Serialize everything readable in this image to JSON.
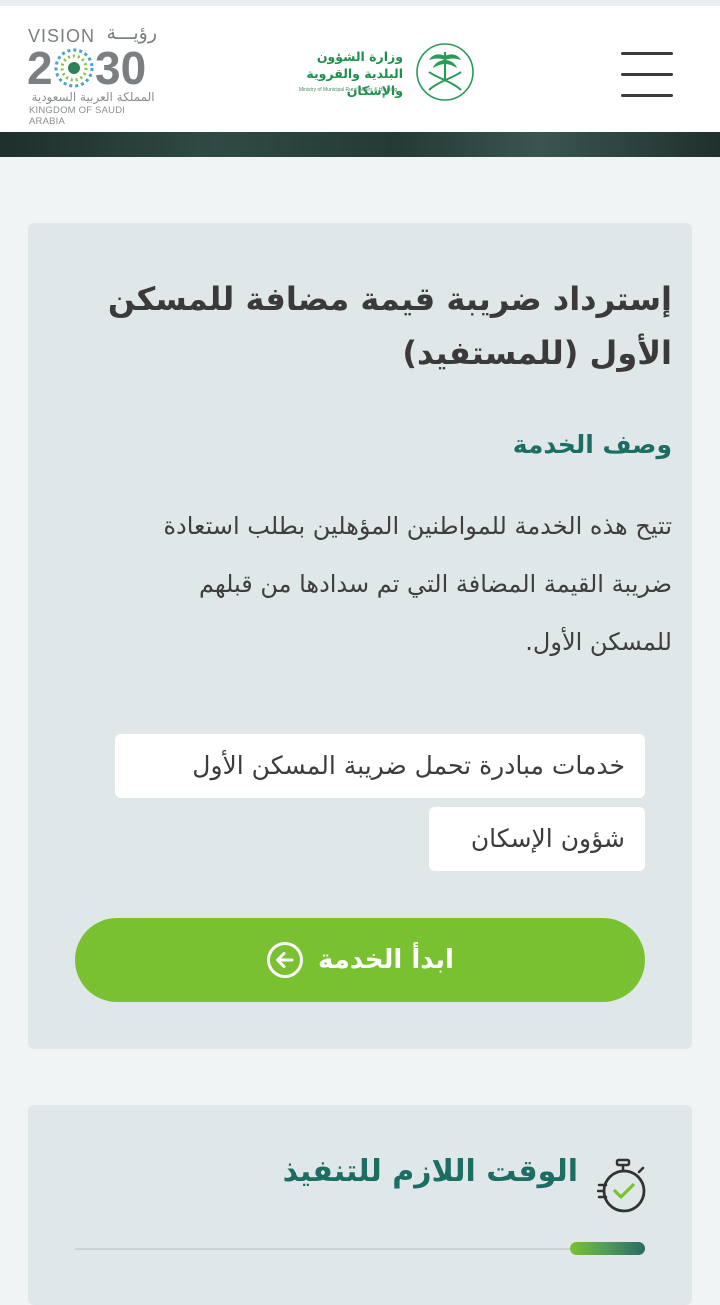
{
  "header": {
    "vision_logo": {
      "en": "VISION",
      "ar": "رؤيـــة",
      "year": "2030",
      "kingdom_ar": "المملكة العربية السعودية",
      "kingdom_en": "KINGDOM OF SAUDI ARABIA"
    },
    "ministry_logo": {
      "name_ar": "وزارة الشؤون البلدية والقروية والإسكان",
      "name_en": "Ministry of Municipal Rural Affairs & Housing"
    },
    "menu_icon": "hamburger-icon"
  },
  "service": {
    "title": "إسترداد ضريبة قيمة مضافة للمسكن الأول (للمستفيد)",
    "description_heading": "وصف الخدمة",
    "description": "تتيح هذه الخدمة للمواطنين المؤهلين بطلب استعادة ضريبة القيمة المضافة التي تم سدادها من قبلهم للمسكن الأول.",
    "tags": [
      "خدمات مبادرة تحمل ضريبة المسكن الأول",
      "شؤون الإسكان"
    ],
    "start_button": {
      "label": "ابدأ الخدمة",
      "icon": "arrow-left-circle-icon"
    }
  },
  "execution_time": {
    "title": "الوقت اللازم للتنفيذ",
    "icon": "stopwatch-icon"
  },
  "colors": {
    "brand_green": "#7ac131",
    "heading_teal": "#1c6d62",
    "card_bg": "#dfe7e9",
    "page_bg": "#f1f4f4"
  }
}
